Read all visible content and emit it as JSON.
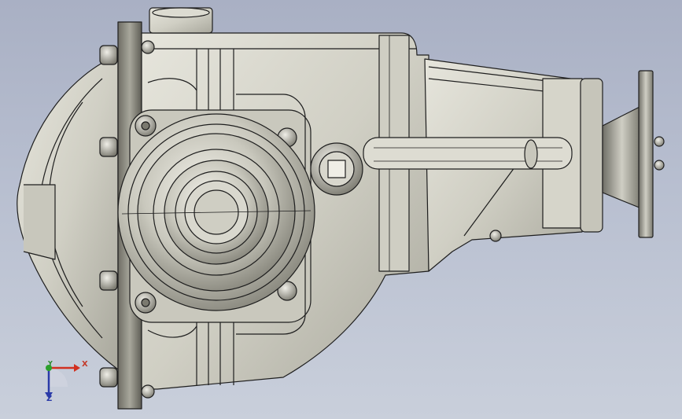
{
  "viewport": {
    "background_top": "#a9b0c4",
    "background_bottom": "#c9cfdb",
    "model_color": "#d4d3c8",
    "edge_color": "#1e1e1e"
  },
  "triad": {
    "x_label": "X",
    "y_label": "Y",
    "z_label": "Z",
    "x_color": "#d23020",
    "y_color": "#2ca02c",
    "z_color": "#2a3aa8"
  }
}
